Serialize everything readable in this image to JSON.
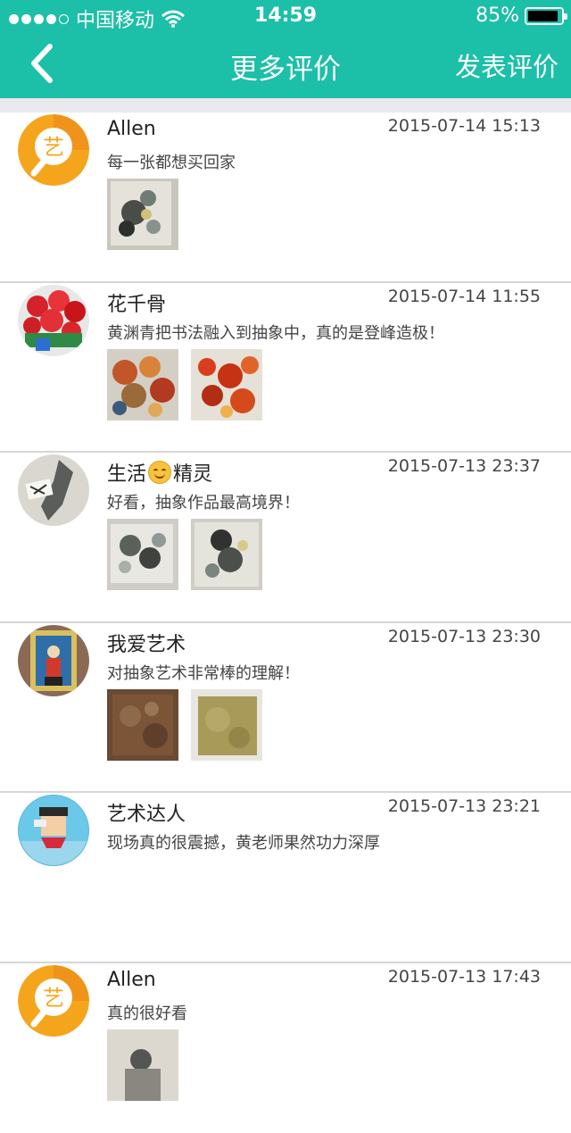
{
  "status_bar": {
    "carrier": "中国移动",
    "time": "14:59",
    "battery": "85%"
  },
  "nav": {
    "title": "更多评价",
    "action_label": "发表评价"
  },
  "comments": [
    {
      "user": "Allen",
      "date": "2015-07-14 15:13",
      "text": "每一张都想买回家"
    },
    {
      "user": "花千骨",
      "date": "2015-07-14 11:55",
      "text": "黄渊青把书法融入到抽象中，真的是登峰造极！"
    },
    {
      "user_part1": "生活",
      "user_part2": "精灵",
      "date": "2015-07-13 23:37",
      "text": "好看，抽象作品最高境界！"
    },
    {
      "user": "我爱艺术",
      "date": "2015-07-13 23:30",
      "text": "对抽象艺术非常棒的理解！"
    },
    {
      "user": "艺术达人",
      "date": "2015-07-13 23:21",
      "text": "现场真的很震撼，黄老师果然功力深厚"
    },
    {
      "user": "Allen",
      "date": "2015-07-13 17:43",
      "text": "真的很好看"
    }
  ],
  "colors": {
    "header": "#1cbfa7",
    "divider": "#d6d6d6"
  }
}
